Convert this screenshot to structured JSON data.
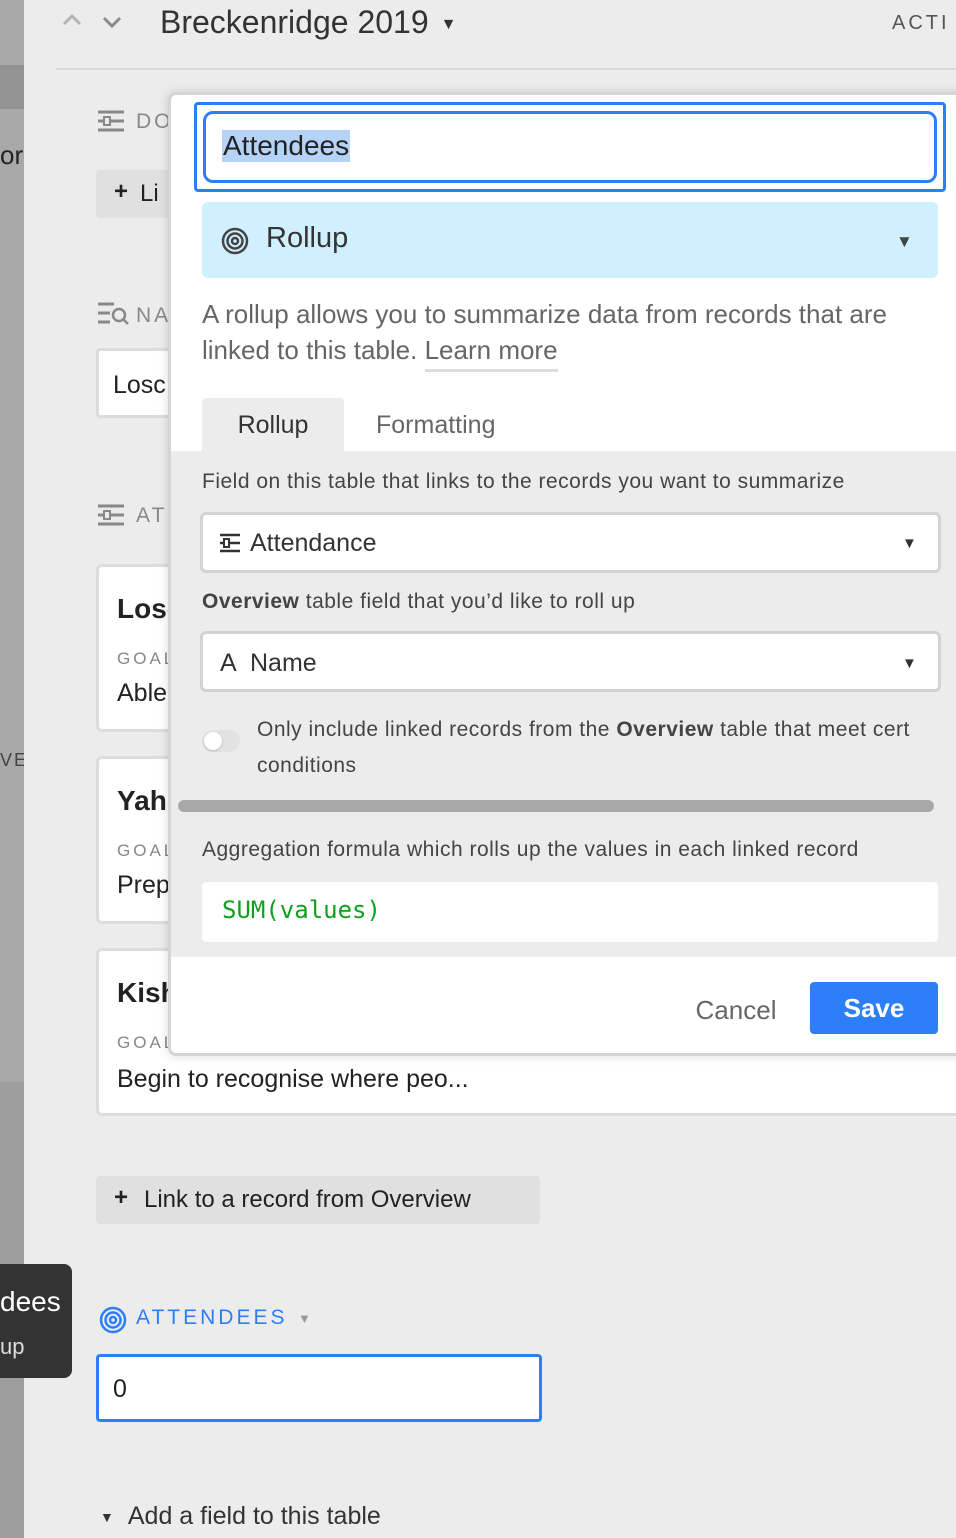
{
  "header": {
    "title": "Breckenridge 2019",
    "activity_label": "ACTI",
    "nav_up_icon": "chevron-up-icon",
    "nav_down_icon": "chevron-down-icon"
  },
  "background_left": {
    "frag_top": "or",
    "frag_mid": "VE"
  },
  "record": {
    "sections": [
      {
        "label": "DO",
        "icon": "linked-record-icon"
      },
      {
        "label": "NA",
        "icon": "name-field-icon"
      },
      {
        "label": "AT",
        "icon": "linked-record-icon"
      }
    ],
    "link_button_top": "Li",
    "name_value": "Losc",
    "cards": [
      {
        "title": "Losc",
        "goal_label": "GOAL",
        "goal_value": "Able"
      },
      {
        "title": "Yah",
        "goal_label": "GOAL",
        "goal_value": "Prep"
      },
      {
        "title": "Kish",
        "goal_label": "GOAL",
        "goal_value": "Begin to recognise where peo..."
      }
    ],
    "link_record_button": "Link to a record from Overview",
    "attendees_label": "ATTENDEES",
    "attendees_value": "0",
    "add_field": "Add a field to this table"
  },
  "tooltip": {
    "line1": "dees",
    "line2": "up"
  },
  "popup": {
    "field_name": "Attendees",
    "field_type": "Rollup",
    "description": "A rollup allows you to summarize data from records that are linked to this table.",
    "learn_more": "Learn more",
    "tabs": [
      "Rollup",
      "Formatting"
    ],
    "link_field_label": "Field on this table that links to the records you want to summarize",
    "link_field_value": "Attendance",
    "rollup_field_label_bold": "Overview",
    "rollup_field_label_rest": " table field that you’d like to roll up",
    "rollup_field_value": "Name",
    "rollup_field_type_glyph": "A",
    "condition_text_1": "Only include linked records from the ",
    "condition_text_bold": "Overview",
    "condition_text_2": " table that meet cert",
    "condition_text_3": "conditions",
    "condition_toggle_on": false,
    "aggregation_label": "Aggregation formula which rolls up the values in each linked record",
    "formula": "SUM(values)",
    "cancel_label": "Cancel",
    "save_label": "Save"
  },
  "colors": {
    "accent": "#2d7ff9",
    "rollup_bg": "#d0efff",
    "formula": "#11a01e"
  }
}
